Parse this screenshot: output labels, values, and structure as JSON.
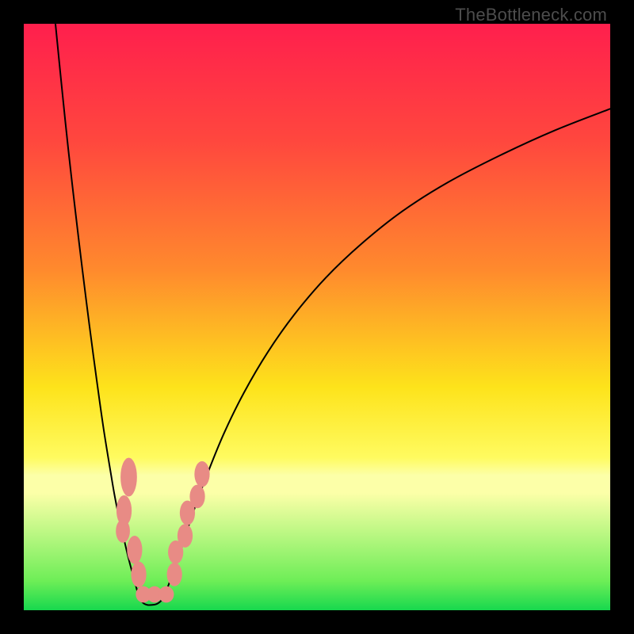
{
  "watermark": "TheBottleneck.com",
  "chart_data": {
    "type": "line",
    "title": "",
    "xlabel": "",
    "ylabel": "",
    "xlim": [
      0,
      100
    ],
    "ylim": [
      0,
      100
    ],
    "gradient_stops": [
      {
        "offset": 0,
        "color": "#ff1f4d"
      },
      {
        "offset": 20,
        "color": "#ff473e"
      },
      {
        "offset": 42,
        "color": "#ff8a2d"
      },
      {
        "offset": 62,
        "color": "#fde31b"
      },
      {
        "offset": 74,
        "color": "#fffb60"
      },
      {
        "offset": 77,
        "color": "#fcffa8"
      },
      {
        "offset": 80,
        "color": "#fcffa8"
      },
      {
        "offset": 95,
        "color": "#6eee57"
      },
      {
        "offset": 100,
        "color": "#17d84e"
      }
    ],
    "series": [
      {
        "name": "left-arm",
        "x": [
          5.4,
          6.5,
          7.6,
          8.8,
          10.0,
          11.2,
          12.4,
          13.6,
          14.9,
          15.5,
          16.2,
          17.0,
          17.7,
          18.4,
          19.1,
          19.7
        ],
        "y": [
          100,
          89,
          78.5,
          68,
          58,
          48.5,
          39.5,
          31,
          23,
          19.5,
          16,
          12.5,
          9.5,
          6.8,
          4.2,
          2.0
        ]
      },
      {
        "name": "valley-floor",
        "x": [
          19.7,
          20.4,
          21.1,
          21.8,
          22.5,
          23.2,
          23.9
        ],
        "y": [
          2.0,
          1.2,
          0.9,
          0.9,
          1.0,
          1.4,
          2.2
        ]
      },
      {
        "name": "right-arm",
        "x": [
          23.9,
          25.3,
          27.0,
          29.0,
          31.4,
          34.2,
          37.6,
          41.6,
          46.2,
          51.5,
          57.6,
          64.5,
          72.4,
          81.3,
          90.5,
          100
        ],
        "y": [
          2.2,
          6.0,
          11.0,
          17.0,
          23.5,
          30.3,
          37.2,
          44.0,
          50.5,
          56.7,
          62.5,
          68.0,
          73.0,
          77.6,
          81.8,
          85.5
        ]
      }
    ],
    "markers": [
      {
        "x": 16.9,
        "y": 13.5,
        "rx": 1.2,
        "ry": 2.0
      },
      {
        "x": 17.1,
        "y": 17.0,
        "rx": 1.3,
        "ry": 2.6
      },
      {
        "x": 17.9,
        "y": 22.7,
        "rx": 1.4,
        "ry": 3.3
      },
      {
        "x": 18.9,
        "y": 10.3,
        "rx": 1.3,
        "ry": 2.4
      },
      {
        "x": 19.6,
        "y": 6.1,
        "rx": 1.3,
        "ry": 2.2
      },
      {
        "x": 20.4,
        "y": 2.7,
        "rx": 1.3,
        "ry": 1.4
      },
      {
        "x": 22.3,
        "y": 2.7,
        "rx": 1.3,
        "ry": 1.4
      },
      {
        "x": 24.3,
        "y": 2.7,
        "rx": 1.3,
        "ry": 1.4
      },
      {
        "x": 25.7,
        "y": 6.1,
        "rx": 1.3,
        "ry": 2.0
      },
      {
        "x": 25.9,
        "y": 9.9,
        "rx": 1.3,
        "ry": 2.0
      },
      {
        "x": 27.5,
        "y": 12.7,
        "rx": 1.3,
        "ry": 2.0
      },
      {
        "x": 27.9,
        "y": 16.6,
        "rx": 1.3,
        "ry": 2.1
      },
      {
        "x": 29.6,
        "y": 19.4,
        "rx": 1.3,
        "ry": 2.0
      },
      {
        "x": 30.4,
        "y": 23.2,
        "rx": 1.3,
        "ry": 2.2
      }
    ],
    "curve_stroke": "#000000",
    "curve_width": 2.0
  }
}
